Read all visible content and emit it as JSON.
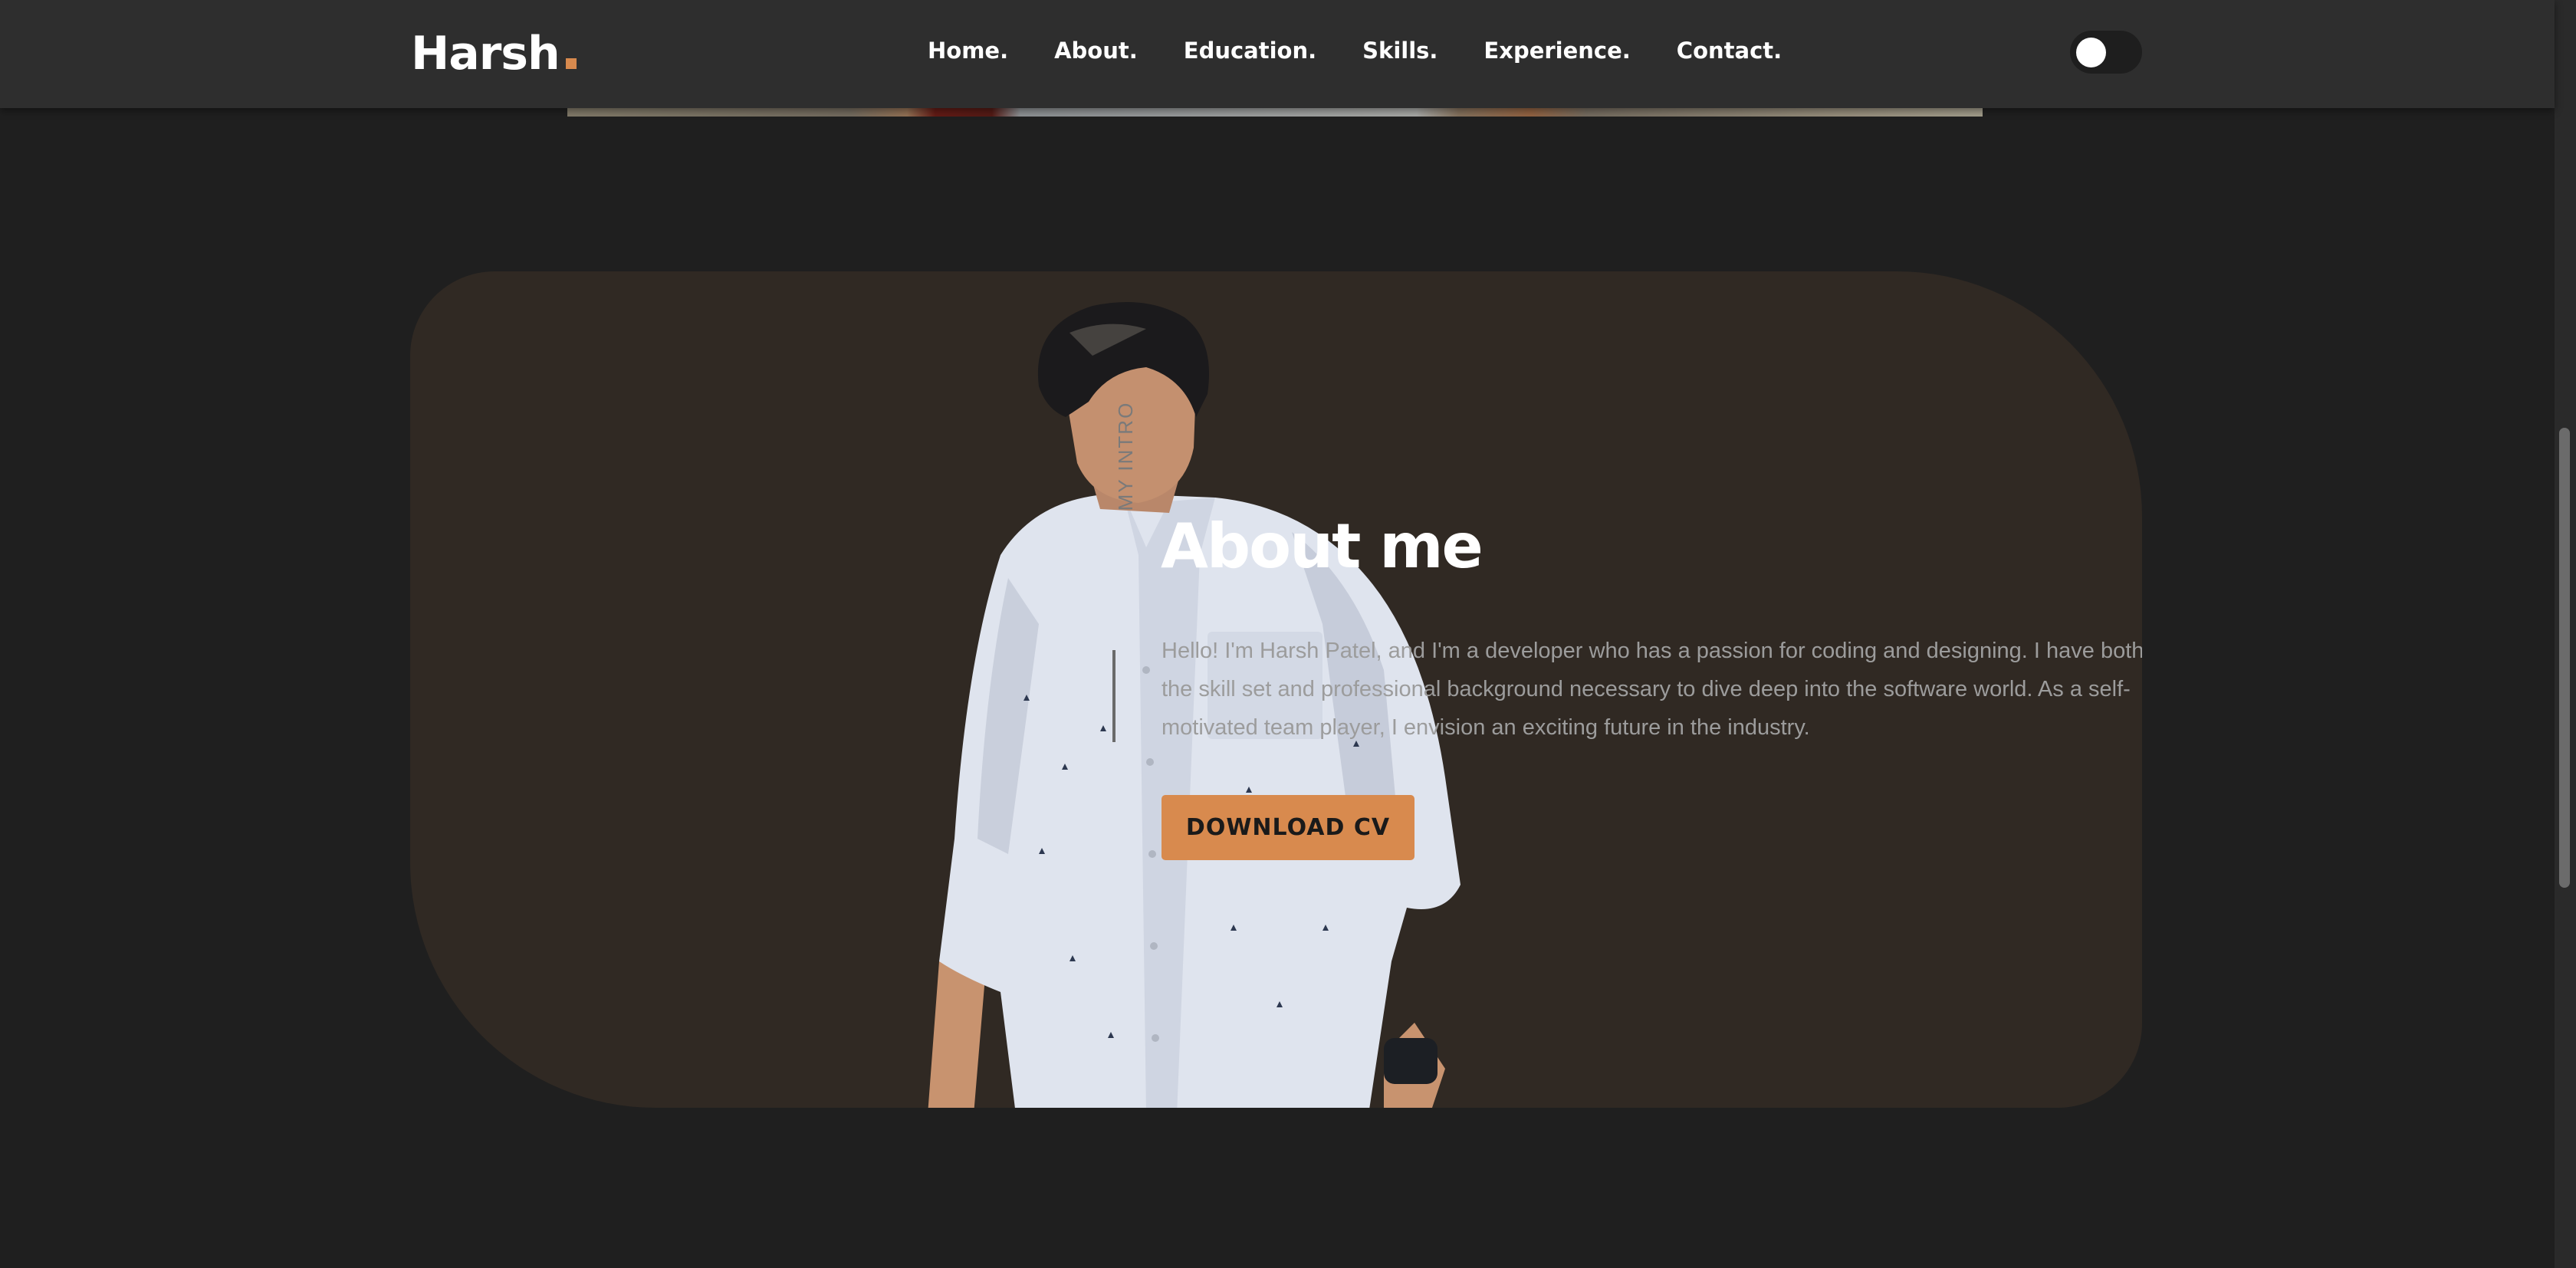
{
  "header": {
    "logo": "Harsh",
    "nav": [
      "Home.",
      "About.",
      "Education.",
      "Skills.",
      "Experience.",
      "Contact."
    ],
    "theme_toggle": "off"
  },
  "about": {
    "side_label": "MY INTRO",
    "title": "About me",
    "description": "Hello! I'm Harsh Patel, and I'm a developer who has a passion for coding and designing. I have both the skill set and professional background necessary to dive deep into the software world. As a self-motivated team player, I envision an exciting future in the industry.",
    "cv_button": "DOWNLOAD CV"
  },
  "colors": {
    "accent": "#d88a4e",
    "background": "#1f1f1f",
    "header": "#2e2e2e",
    "card": "#302923"
  }
}
